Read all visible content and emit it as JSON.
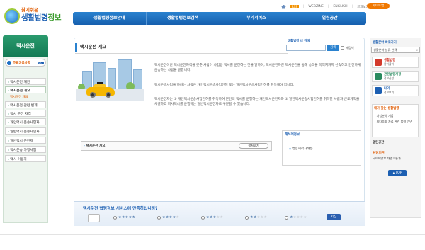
{
  "header": {
    "logo_sub": "찾기쉬운",
    "logo_main_a": "생활법령",
    "logo_main_b": "정보",
    "util": [
      "RSS",
      "WEBZINE",
      "ENGLISH"
    ],
    "font_size_label": "글자보기",
    "sitemap_label": "사이트맵",
    "gnb": [
      "생활법령정보안내",
      "생활법령정보검색",
      "부가서비스",
      "열린공간"
    ]
  },
  "sidebar": {
    "title": "택시운전",
    "keyword_label": "주요궁금사항",
    "keyword_go": "GO",
    "items": [
      {
        "label": "택시운전 개관",
        "active": false
      },
      {
        "label": "택시운전 개요",
        "active": true
      },
      {
        "label": "택시운전 관련 법제",
        "active": false
      },
      {
        "label": "택시 운전 자격",
        "active": false
      },
      {
        "label": "개인택시 운송사업자",
        "active": false
      },
      {
        "label": "일반택시 운송사업자",
        "active": false
      },
      {
        "label": "일반택시 운전자",
        "active": false
      },
      {
        "label": "택시운송 가맹사업",
        "active": false
      },
      {
        "label": "택시 이용자",
        "active": false
      }
    ],
    "sub_item": "택시운전 개요"
  },
  "search": {
    "label": "생활법령 내 검색",
    "button": "검색",
    "checkbox_label": "재검색"
  },
  "main": {
    "page_title": "택시운전 개요",
    "paragraphs": [
      "택시운전이란 택시운전자격을 갖춘 사람이 사업용 택시를 운전하는 것을 말하며, 택시운전자란 택시운전을 통해 승객을 목적지까지 신속하고 안전하게 운송하는 사람을 말합니다.",
      "택시운송사업을 하려는 사람은 개인택시운송사업면허 또는 일반택시운송사업면허를 취득해야 합니다.",
      "택시운전자는 ① 개인택시운송사업면허를 취득하여 본인의 택시를 운행하는 개인택시운전자와 ② 일반택시운송사업면허를 취득한 사람과 근로계약을 체결하고 회사택시를 운행하는 일반택시운전자로 구분할 수 있습니다."
    ],
    "toc_link": "택시운전 개요",
    "toc_button": "펼쳐보기",
    "related_title": "해석례정보",
    "related_link": "법령해석사례등"
  },
  "survey": {
    "question": "택시운전 법령정보 서비스에 만족하십니까?",
    "options": [
      5,
      4,
      3,
      2,
      1
    ],
    "button": "저장"
  },
  "quick": {
    "title": "생활분야 바로가기",
    "select_value": "생활분야 분류 선택",
    "cards": [
      {
        "title": "생활법령",
        "sub": "용어풀이",
        "color": "#d33a2c"
      },
      {
        "title": "관련법령개정",
        "sub": "정보신청",
        "color": "#2a8a5f"
      },
      {
        "title": "나의",
        "sub": "정보보기",
        "color": "#1c5fb2"
      }
    ],
    "box_title": "내가 찾는 생활법령",
    "box_items": [
      "가입분야 개념",
      "최다조회 자료 관련 법령 가면"
    ],
    "link_title": "열린공간",
    "dept_label": "담당기관",
    "dept_name": "국토해양부 대중교통과",
    "top_label": "TOP"
  }
}
